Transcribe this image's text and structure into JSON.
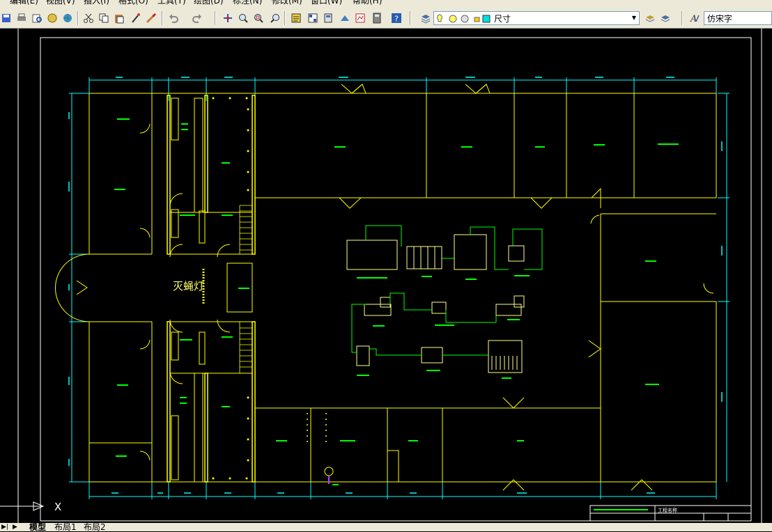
{
  "menu": [
    {
      "id": "edit",
      "label": "编辑(E)"
    },
    {
      "id": "view",
      "label": "视图(V)"
    },
    {
      "id": "insert",
      "label": "插入(I)"
    },
    {
      "id": "format",
      "label": "格式(O)"
    },
    {
      "id": "tools",
      "label": "工具(T)"
    },
    {
      "id": "draw",
      "label": "绘图(D)"
    },
    {
      "id": "dimension",
      "label": "标注(N)"
    },
    {
      "id": "modify",
      "label": "修改(M)"
    },
    {
      "id": "window",
      "label": "窗口(W)"
    },
    {
      "id": "help",
      "label": "帮助(H)"
    }
  ],
  "toolbar": {
    "layer_combo_value": "尺寸",
    "textstyle_combo_value": "仿宋字"
  },
  "drawing": {
    "lamp_label": "灭蝇灯",
    "ucs_x_label": "X",
    "title_block_label": "工程名称"
  },
  "layout_tabs": [
    {
      "id": "model",
      "label": "模型"
    },
    {
      "id": "layout1",
      "label": "布局1"
    },
    {
      "id": "layout2",
      "label": "布局2"
    }
  ],
  "colors": {
    "background": "#000000",
    "wall_yellow": "#ffff00",
    "dimension_cyan": "#00ffff",
    "equipment_green": "#00ff00",
    "frame_white": "#ffffff"
  }
}
